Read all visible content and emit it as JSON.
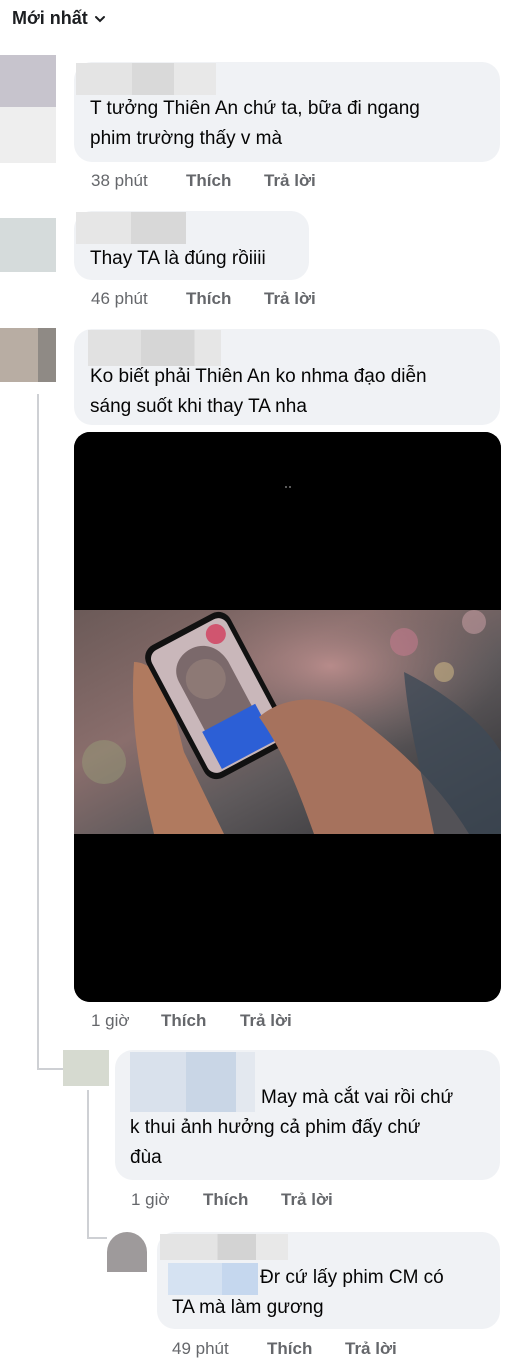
{
  "sort": {
    "label": "Mới nhất",
    "icon": "chevron-down-icon"
  },
  "comments": [
    {
      "text_lines": [
        "T tưởng Thiên An chứ ta, bữa đi ngang",
        "phim trường thấy v mà"
      ],
      "time": "38 phút",
      "like": "Thích",
      "reply": "Trả lời"
    },
    {
      "text_lines": [
        "Thay TA là đúng rồiiii"
      ],
      "time": "46 phút",
      "like": "Thích",
      "reply": "Trả lời"
    },
    {
      "text_lines": [
        "Ko biết phải Thiên An ko nhma đạo diễn",
        "sáng suốt khi thay TA nha"
      ],
      "time": "1 giờ",
      "like": "Thích",
      "reply": "Trả lời",
      "media": "video-thumbnail"
    }
  ],
  "replies": [
    {
      "text_lines": [
        "May mà cắt vai rồi chứ",
        "k thui ảnh hưởng cả phim đấy chứ",
        "đùa"
      ],
      "time": "1 giờ",
      "like": "Thích",
      "reply": "Trả lời"
    },
    {
      "text_lines": [
        "Đr cứ lấy phim CM có",
        "TA mà làm gương"
      ],
      "time": "49 phút",
      "like": "Thích",
      "reply": "Trả lời"
    }
  ],
  "colors": {
    "bubble": "#f0f2f5",
    "meta": "#65676b",
    "thread_line": "#ced0d4"
  }
}
